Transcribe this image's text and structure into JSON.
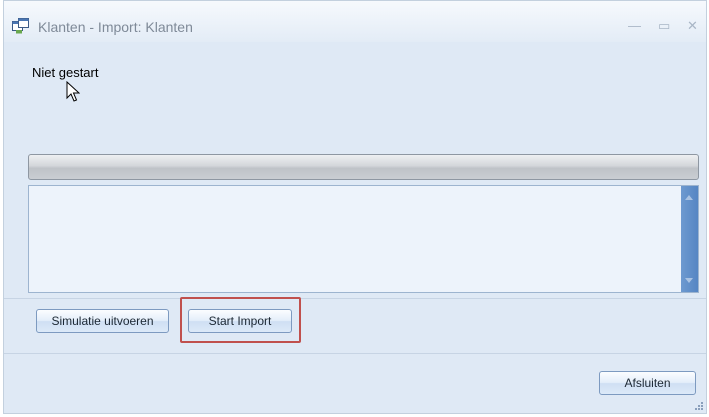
{
  "window": {
    "title": "Klanten - Import: Klanten",
    "controls": [
      "minimize-icon",
      "maximize-icon",
      "close-icon"
    ],
    "icon": "import-window-icon"
  },
  "status": {
    "text": "Niet gestart"
  },
  "progress": {
    "value": 0
  },
  "log": {
    "content": ""
  },
  "buttons": {
    "simulate": "Simulatie uitvoeren",
    "start": "Start Import",
    "close": "Afsluiten"
  },
  "colors": {
    "background": "#dfe9f5",
    "highlight": "#c0504d",
    "scrollbar": "#5f8ecb"
  }
}
